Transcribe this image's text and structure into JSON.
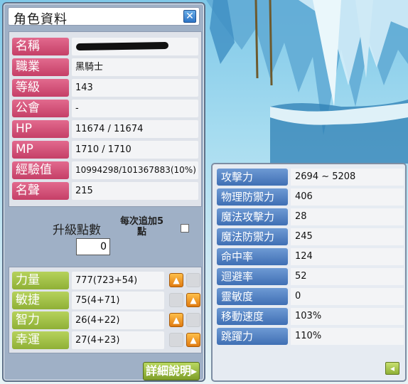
{
  "window": {
    "title": "角色資料",
    "close_glyph": "✕"
  },
  "profile": [
    {
      "label": "名稱",
      "value": "",
      "redacted": true
    },
    {
      "label": "職業",
      "value": "黑騎士"
    },
    {
      "label": "等級",
      "value": "143"
    },
    {
      "label": "公會",
      "value": "-"
    },
    {
      "label": "HP",
      "value": "11674 / 11674"
    },
    {
      "label": "MP",
      "value": "1710 / 1710"
    },
    {
      "label": "經驗值",
      "value": "10994298/101367883(10%)"
    },
    {
      "label": "名聲",
      "value": "215"
    }
  ],
  "ap": {
    "title": "升級點數",
    "value": "0",
    "each_label_1": "每次追加5",
    "each_label_2": "點"
  },
  "stats": [
    {
      "label": "力量",
      "value": "777(723+54)"
    },
    {
      "label": "敏捷",
      "value": "75(4+71)"
    },
    {
      "label": "智力",
      "value": "26(4+22)"
    },
    {
      "label": "幸運",
      "value": "27(4+23)"
    }
  ],
  "detail_button": "詳細說明",
  "details": [
    {
      "label": "攻擊力",
      "value": "2694 ~ 5208"
    },
    {
      "label": "物理防禦力",
      "value": "406"
    },
    {
      "label": "魔法攻擊力",
      "value": "28"
    },
    {
      "label": "魔法防禦力",
      "value": "245"
    },
    {
      "label": "命中率",
      "value": "124"
    },
    {
      "label": "迴避率",
      "value": "52"
    },
    {
      "label": "靈敏度",
      "value": "0"
    },
    {
      "label": "移動速度",
      "value": "103%"
    },
    {
      "label": "跳躍力",
      "value": "110%"
    }
  ],
  "icons": {
    "close": "close-icon",
    "up": "arrow-up-icon",
    "back": "arrow-left-icon"
  },
  "colors": {
    "pink_label": "#d2527a",
    "green_label": "#a2c247",
    "blue_label": "#5584c4",
    "window_bg": "#9fb0c6"
  }
}
